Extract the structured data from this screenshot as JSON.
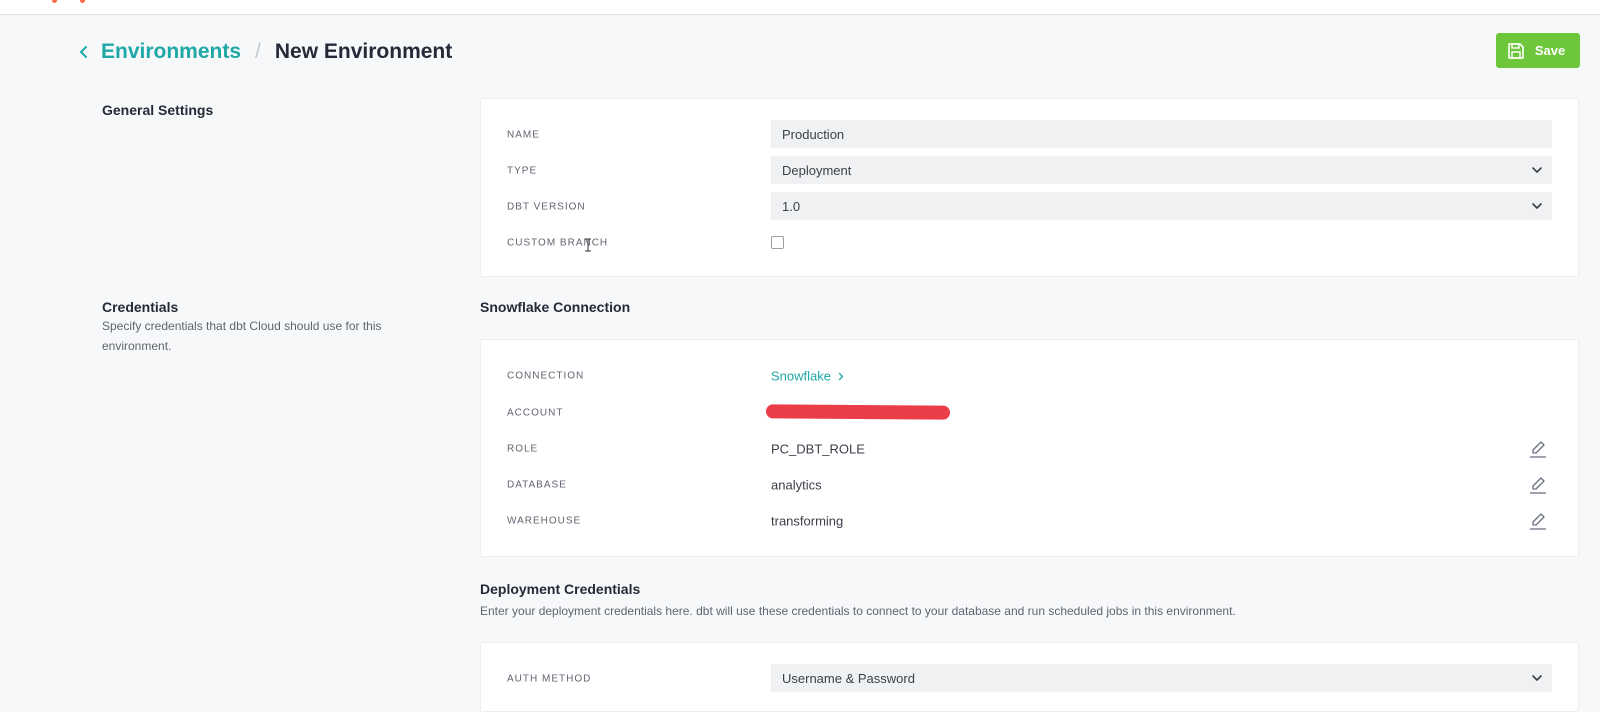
{
  "header": {
    "breadcrumb_parent": "Environments",
    "breadcrumb_separator": "/",
    "breadcrumb_current": "New Environment",
    "save_label": "Save"
  },
  "general": {
    "section_title": "General Settings",
    "fields": {
      "name": {
        "label": "NAME",
        "value": "Production"
      },
      "type": {
        "label": "TYPE",
        "value": "Deployment"
      },
      "dbt_version": {
        "label": "DBT VERSION",
        "value": "1.0"
      },
      "custom_branch": {
        "label": "CUSTOM BRANCH",
        "checked": false
      }
    }
  },
  "credentials": {
    "section_title": "Credentials",
    "section_desc": "Specify credentials that dbt Cloud should use for this environment.",
    "connection_title": "Snowflake Connection",
    "fields": {
      "connection": {
        "label": "CONNECTION",
        "value": "Snowflake"
      },
      "account": {
        "label": "ACCOUNT"
      },
      "role": {
        "label": "ROLE",
        "value": "PC_DBT_ROLE"
      },
      "database": {
        "label": "DATABASE",
        "value": "analytics"
      },
      "warehouse": {
        "label": "WAREHOUSE",
        "value": "transforming"
      }
    }
  },
  "deployment": {
    "title": "Deployment Credentials",
    "desc": "Enter your deployment credentials here. dbt will use these credentials to connect to your database and run scheduled jobs in this environment.",
    "fields": {
      "auth_method": {
        "label": "AUTH METHOD",
        "value": "Username & Password"
      }
    }
  },
  "colors": {
    "accent": "#1fa8a6",
    "save_button": "#6ec63a",
    "redaction": "#ea3d48",
    "background": "#f7f8fa"
  }
}
